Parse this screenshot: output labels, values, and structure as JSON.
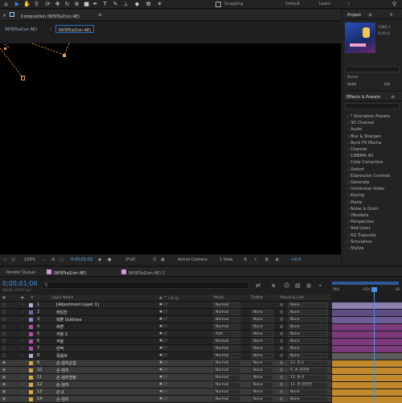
{
  "toolbar": {
    "snapping_label": "Snapping",
    "workspaces": [
      "Default",
      "Learn"
    ],
    "tools": [
      "selection-tool",
      "hand-tool",
      "zoom-tool",
      "orbit-tool",
      "pan-behind-tool",
      "rectangle-tool",
      "pen-tool",
      "type-tool",
      "brush-tool",
      "clone-tool",
      "eraser-tool",
      "roto-tool",
      "puppet-tool"
    ]
  },
  "composition": {
    "tab_label": "Composition 06레저a2(on AE)",
    "tab_name": "06레저a2(on AE)",
    "breadcrumb_left": "06레저a2(on AE)",
    "breadcrumb_right": "06레저a2(on AE)"
  },
  "viewer_bar": {
    "zoom": "100%",
    "timecode": "0;00;01;02",
    "resolution": "(Full)",
    "camera": "Active Camera",
    "views": "1 View",
    "exposure": "+0.0"
  },
  "project_panel": {
    "tab": "Project",
    "info1": "1080 x",
    "info2": "0;00;0",
    "col_name": "Name",
    "item1": "Solid",
    "item2": "Efe"
  },
  "effects_panel": {
    "tab": "Effects & Presets",
    "items": [
      "* Animation Presets",
      "3D Channel",
      "Audio",
      "Blur & Sharpen",
      "Boris FX Mocha",
      "Channel",
      "CINEMA 4D",
      "Color Correction",
      "Distort",
      "Expression Controls",
      "Generate",
      "Immersive Video",
      "Keying",
      "Matte",
      "Noise & Grain",
      "Obsolete",
      "Perspective",
      "Red Giant",
      "RG Trapcode",
      "Simulation",
      "Stylize"
    ]
  },
  "timeline": {
    "tabs": [
      "Render Queue",
      "06레저a2(on AE)",
      "06레저a2(on AE) 2"
    ],
    "current_time": "0;00;01;06",
    "frame_info": "00036 (29.97 fps)",
    "ruler": [
      "00s",
      "01s",
      "02"
    ],
    "columns": {
      "name": "Layer Name",
      "mode": "Mode",
      "trkmat": "TrkMat",
      "parent": "Parent & Link"
    },
    "layers": [
      {
        "num": "1",
        "name": "[Adjustment Layer 1]",
        "mode": "Normal",
        "trk": "",
        "parent": "None",
        "color": "#b8a8d8",
        "bar": "#8b7fb0"
      },
      {
        "num": "2",
        "name": "레일찬",
        "mode": "Normal",
        "trk": "None",
        "parent": "None",
        "color": "#7a64a8",
        "bar": "#5d4b82"
      },
      {
        "num": "3",
        "name": "레쁜 Outlines",
        "mode": "Normal",
        "trk": "None",
        "parent": "None",
        "color": "#9a82c4",
        "bar": "#6f5d97"
      },
      {
        "num": "4",
        "name": "레쁜",
        "mode": "Normal",
        "trk": "None",
        "parent": "None",
        "color": "#b34db0",
        "bar": "#7d3a7b"
      },
      {
        "num": "5",
        "name": "겨울 2",
        "mode": "Add",
        "trk": "None",
        "parent": "None",
        "color": "#b34db0",
        "bar": "#7d3a7b"
      },
      {
        "num": "6",
        "name": "겨울",
        "mode": "Normal",
        "trk": "None",
        "parent": "None",
        "color": "#b34db0",
        "bar": "#7d3a7b"
      },
      {
        "num": "7",
        "name": "반짝",
        "mode": "Normal",
        "trk": "None",
        "parent": "None",
        "color": "#b34db0",
        "bar": "#7d3a7b"
      },
      {
        "num": "8",
        "name": "목음바",
        "mode": "Normal",
        "trk": "None",
        "parent": "None",
        "color": "#b8a8d8",
        "bar": "#5c5c5c"
      },
      {
        "num": "9",
        "name": "손-검지손잡",
        "mode": "Normal",
        "trk": "None",
        "parent": "13. 손-2",
        "color": "#d9a640",
        "bar": "#c08a2c"
      },
      {
        "num": "10",
        "name": "손-엄지",
        "mode": "Normal",
        "trk": "None",
        "parent": "9. 손-검지손",
        "color": "#d9a640",
        "bar": "#c08a2c"
      },
      {
        "num": "11",
        "name": "손-검지연질",
        "mode": "Normal",
        "trk": "None",
        "parent": "13. 손-2",
        "color": "#d9a640",
        "bar": "#c08a2c"
      },
      {
        "num": "12",
        "name": "손-검지",
        "mode": "Normal",
        "trk": "None",
        "parent": "11. 손-검지연",
        "color": "#d9a640",
        "bar": "#c08a2c"
      },
      {
        "num": "13",
        "name": "손-2",
        "mode": "Normal",
        "trk": "None",
        "parent": "None",
        "color": "#d9a640",
        "bar": "#c08a2c"
      },
      {
        "num": "14",
        "name": "손-엄지",
        "mode": "Normal",
        "trk": "None",
        "parent": "None",
        "color": "#d9a640",
        "bar": "#c08a2c"
      }
    ]
  },
  "colors": {
    "accent": "#2d8ceb",
    "playhead": "#4b8fe8",
    "viewer_bg": "#000000",
    "keyframe": "#f0a030"
  }
}
